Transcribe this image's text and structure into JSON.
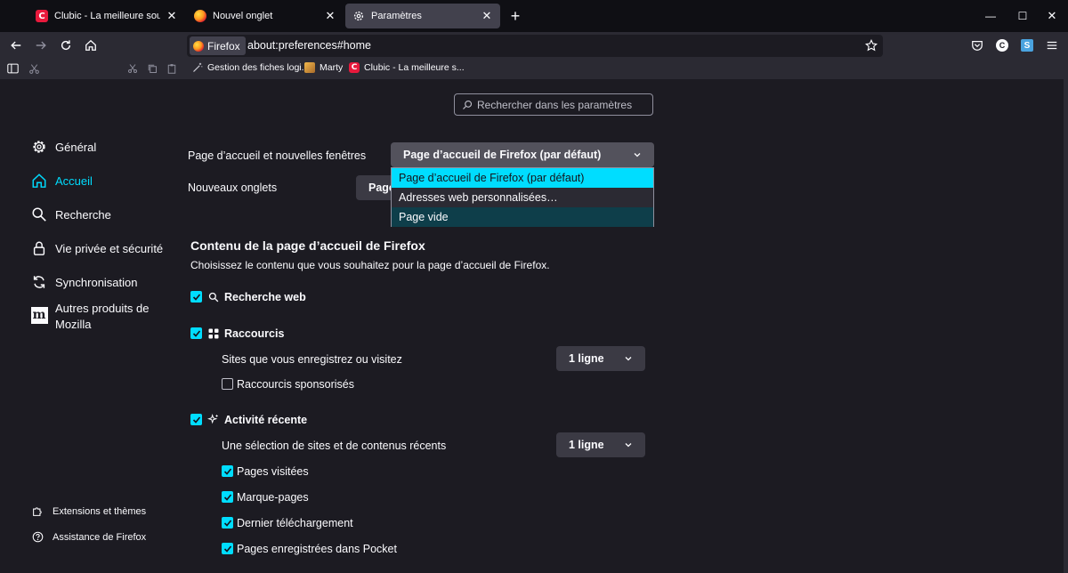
{
  "tabs": [
    {
      "label": "Clubic - La meilleure source d'in",
      "icon": "clubic-icon",
      "active": false
    },
    {
      "label": "Nouvel onglet",
      "icon": "firefox-icon",
      "active": false
    },
    {
      "label": "Paramètres",
      "icon": "gear-icon",
      "active": true
    }
  ],
  "window_controls": {
    "minimize": "—",
    "maximize": "☐",
    "close": "✕",
    "new_tab": "+"
  },
  "navbar": {
    "identity_label": "Firefox",
    "url": "about:preferences#home"
  },
  "bookmarks": [
    {
      "label": "Gestion des fiches logi...",
      "icon": "wand-icon"
    },
    {
      "label": "Marty",
      "icon": "avatar-icon"
    },
    {
      "label": "Clubic - La meilleure s...",
      "icon": "clubic-icon"
    }
  ],
  "search": {
    "placeholder": "Rechercher dans les paramètres"
  },
  "sidebar": {
    "items": [
      {
        "label": "Général",
        "icon": "gear-icon",
        "selected": false
      },
      {
        "label": "Accueil",
        "icon": "home-icon",
        "selected": true
      },
      {
        "label": "Recherche",
        "icon": "search-icon",
        "selected": false
      },
      {
        "label": "Vie privée et sécurité",
        "icon": "lock-icon",
        "selected": false
      },
      {
        "label": "Synchronisation",
        "icon": "sync-icon",
        "selected": false
      },
      {
        "label": "Autres produits de",
        "label2": "Mozilla",
        "icon": "mozilla-icon",
        "selected": false
      }
    ],
    "footer": [
      {
        "label": "Extensions et thèmes",
        "icon": "puzzle-icon"
      },
      {
        "label": "Assistance de Firefox",
        "icon": "help-icon"
      }
    ]
  },
  "home": {
    "homepage_label": "Page d’accueil et nouvelles fenêtres",
    "homepage_value": "Page d’accueil de Firefox (par défaut)",
    "newtab_label": "Nouveaux onglets",
    "newtab_value": "Page",
    "dropdown_options": [
      {
        "label": "Page d’accueil de Firefox (par défaut)",
        "state": "selected"
      },
      {
        "label": "Adresses web personnalisées…",
        "state": "normal"
      },
      {
        "label": "Page vide",
        "state": "hover"
      }
    ],
    "section_title": "Contenu de la page d’accueil de Firefox",
    "section_desc": "Choisissez le contenu que vous souhaitez pour la page d’accueil de Firefox.",
    "web_search": {
      "label": "Recherche web",
      "checked": true
    },
    "shortcuts": {
      "label": "Raccourcis",
      "checked": true,
      "rows_label": "Sites que vous enregistrez ou visitez",
      "rows_value": "1 ligne",
      "sponsored": {
        "label": "Raccourcis sponsorisés",
        "checked": false
      }
    },
    "recent": {
      "label": "Activité récente",
      "checked": true,
      "rows_label": "Une sélection de sites et de contenus récents",
      "rows_value": "1 ligne",
      "options": [
        {
          "label": "Pages visitées",
          "checked": true
        },
        {
          "label": "Marque-pages",
          "checked": true
        },
        {
          "label": "Dernier téléchargement",
          "checked": true
        },
        {
          "label": "Pages enregistrées dans Pocket",
          "checked": true
        }
      ]
    }
  },
  "colors": {
    "accent": "#00ddff",
    "bg": "#1c1b22",
    "toolbar": "#2b2a33",
    "tabstrip": "#0f0f14"
  }
}
